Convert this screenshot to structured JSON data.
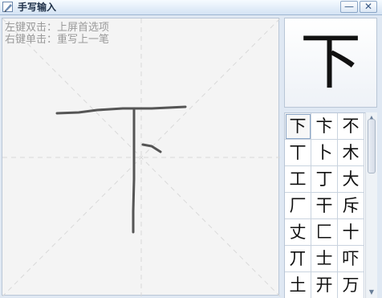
{
  "window": {
    "title": "手写输入",
    "minimize_icon": "minimize-icon",
    "close_icon": "close-icon"
  },
  "pad": {
    "hint_double_click": "左键双击：上屏首选项",
    "hint_single_click": "右键单击：重写上一笔"
  },
  "preview": {
    "char": "下"
  },
  "candidates": [
    "下",
    "卞",
    "不",
    "丅",
    "卜",
    "木",
    "工",
    "丁",
    "大",
    "厂",
    "干",
    "斥",
    "丈",
    "匚",
    "十",
    "丌",
    "士",
    "吓",
    "土",
    "开",
    "万"
  ],
  "selected_index": 0
}
